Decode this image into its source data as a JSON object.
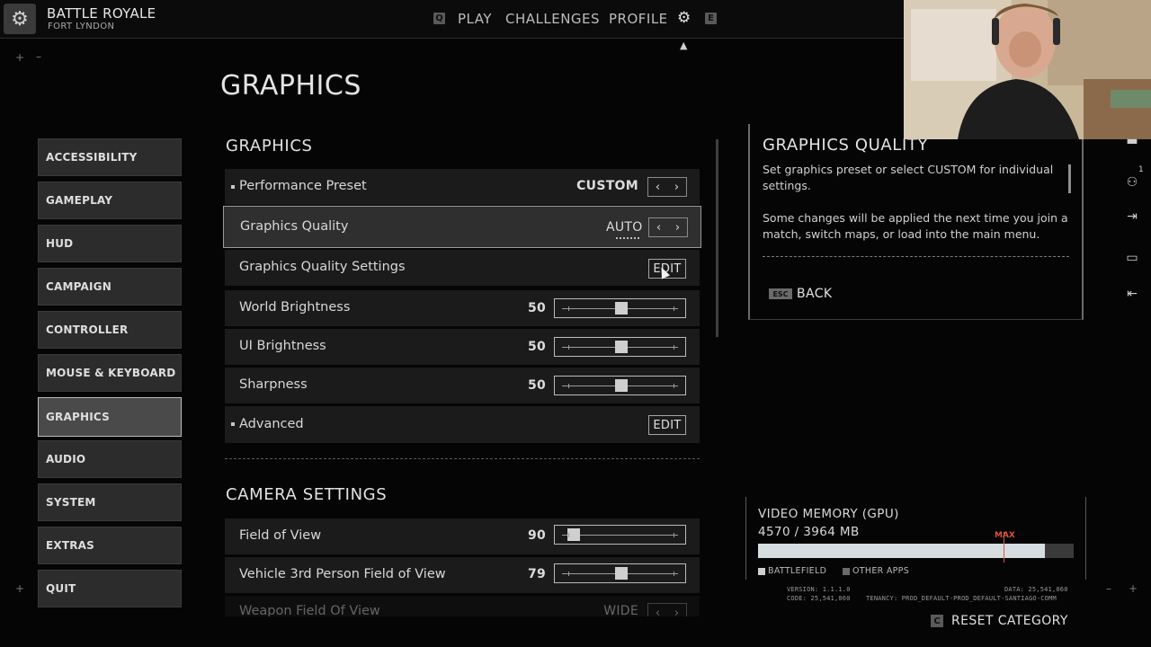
{
  "header": {
    "mode_title": "BATTLE ROYALE",
    "mode_subtitle": "FORT LYNDON",
    "left_key": "Q",
    "right_key": "E",
    "nav": [
      "PLAY",
      "CHALLENGES",
      "PROFILE"
    ]
  },
  "page_title": "GRAPHICS",
  "sidebar": {
    "items": [
      {
        "label": "ACCESSIBILITY",
        "active": false
      },
      {
        "label": "GAMEPLAY",
        "active": false
      },
      {
        "label": "HUD",
        "active": false
      },
      {
        "label": "CAMPAIGN",
        "active": false
      },
      {
        "label": "CONTROLLER",
        "active": false
      },
      {
        "label": "MOUSE & KEYBOARD",
        "active": false
      },
      {
        "label": "GRAPHICS",
        "active": true
      },
      {
        "label": "AUDIO",
        "active": false
      },
      {
        "label": "SYSTEM",
        "active": false
      },
      {
        "label": "EXTRAS",
        "active": false
      },
      {
        "label": "QUIT",
        "active": false
      }
    ]
  },
  "graphics_section": {
    "title": "GRAPHICS",
    "rows": {
      "preset": {
        "label": "Performance Preset",
        "value": "CUSTOM"
      },
      "quality": {
        "label": "Graphics Quality",
        "value": "AUTO"
      },
      "quality_settings": {
        "label": "Graphics Quality Settings",
        "button": "EDIT"
      },
      "world_brightness": {
        "label": "World Brightness",
        "value": "50",
        "level": 0.5
      },
      "ui_brightness": {
        "label": "UI Brightness",
        "value": "50",
        "level": 0.5
      },
      "sharpness": {
        "label": "Sharpness",
        "value": "50",
        "level": 0.5
      },
      "advanced": {
        "label": "Advanced",
        "button": "EDIT"
      }
    }
  },
  "camera_section": {
    "title": "CAMERA SETTINGS",
    "rows": {
      "fov": {
        "label": "Field of View",
        "value": "90",
        "level": 0.1
      },
      "vehicle_fov": {
        "label": "Vehicle 3rd Person Field of View",
        "value": "79",
        "level": 0.5
      },
      "weapon_fov": {
        "label": "Weapon Field Of View",
        "value": "WIDE"
      }
    }
  },
  "info_panel": {
    "title": "GRAPHICS QUALITY",
    "text1": "Set graphics preset or select CUSTOM for individual settings.",
    "text2": "Some changes will be applied the next time you join a match, switch maps, or load into the main menu.",
    "esc_key": "ESC",
    "back_label": "BACK"
  },
  "side_tools": {
    "badge": "1"
  },
  "video_memory": {
    "title": "VIDEO MEMORY (GPU)",
    "value": "4570 / 3964 MB",
    "max_label": "MAX",
    "usage_level": 0.91,
    "max_marker": 0.778,
    "legend": [
      "BATTLEFIELD",
      "OTHER APPS"
    ],
    "version_line": "VERSION: 1.1.1.0",
    "code_line": "CODE: 25,541,060",
    "data_line": "DATA: 25,541,060",
    "tenancy_line": "TENANCY: PROD_DEFAULT-PROD_DEFAULT-SANTIAGO-COMM"
  },
  "footer": {
    "reset_key": "C",
    "reset_label": "RESET CATEGORY"
  },
  "colors": {
    "accent_max": "#d9533a",
    "panel_bg": "#1b1b1b",
    "highlight_border": "#9a9a9a"
  }
}
